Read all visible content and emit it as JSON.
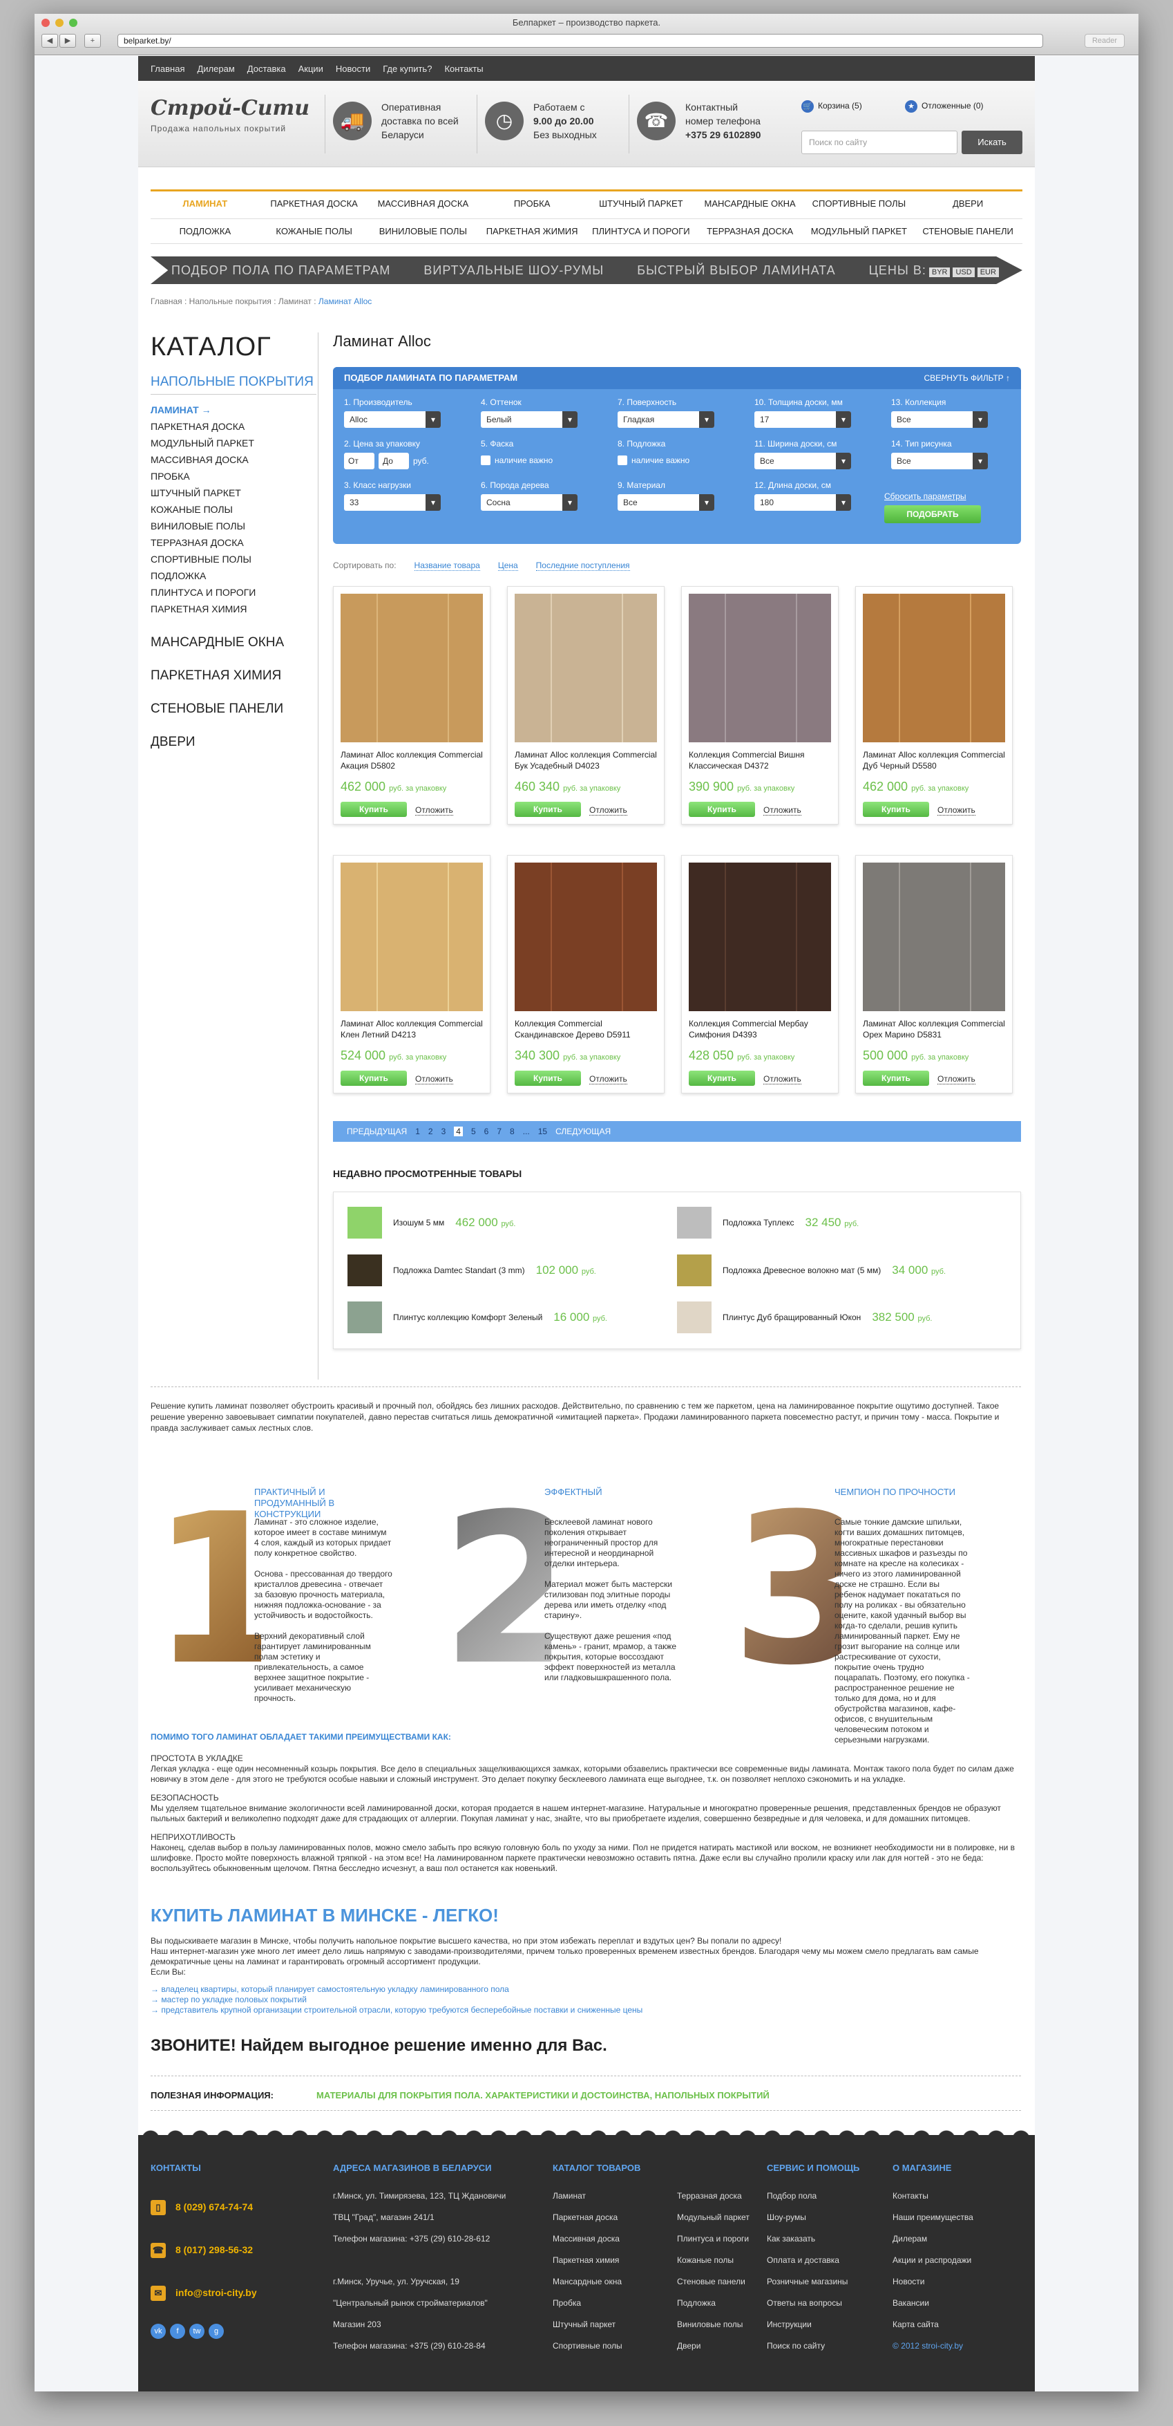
{
  "browser": {
    "window_title": "Белпаркет – производство паркета.",
    "url": "belparket.by/",
    "reader": "Reader"
  },
  "topnav": [
    "Главная",
    "Дилерам",
    "Доставка",
    "Акции",
    "Новости",
    "Где купить?",
    "Контакты"
  ],
  "header": {
    "logo": "Строй-Сити",
    "logo_sub": "Продажа напольных покрытий",
    "delivery": [
      "Оперативная",
      "доставка по всей",
      "Беларуси"
    ],
    "hours": [
      "Работаем с",
      "9.00 до 20.00",
      "Без выходных"
    ],
    "phone": [
      "Контактный",
      "номер телефона",
      "+375 29 6102890"
    ],
    "cart": "Корзина (5)",
    "favorites": "Отложенные (0)",
    "search_placeholder": "Поиск по сайту",
    "search_button": "Искать"
  },
  "categories_row1": [
    "Ламинат",
    "Паркетная доска",
    "Массивная доска",
    "Пробка",
    "Штучный паркет",
    "Мансардные окна",
    "Спортивные полы",
    "Двери"
  ],
  "categories_row2": [
    "Подложка",
    "Кожаные полы",
    "Виниловые полы",
    "Паркетная жимия",
    "Плинтуса и пороги",
    "Терразная доска",
    "Модульный паркет",
    "Стеновые панели"
  ],
  "promo": {
    "items": [
      "Подбор пола по параметрам",
      "Виртуальные шоу-румы",
      "Быстрый выбор ламината"
    ],
    "currency_label": "Цены в:",
    "currencies": [
      "BYR",
      "USD",
      "EUR"
    ]
  },
  "breadcrumb": {
    "path": "Главная : Напольные покрытия : Ламинат :",
    "current": "Ламинат Alloc"
  },
  "sidebar": {
    "title": "Каталог",
    "section": "Напольные покрытия",
    "items": [
      "Ламинат →",
      "Паркетная доска",
      "Модульный паркет",
      "Массивная доска",
      "Пробка",
      "Штучный паркет",
      "Кожаные полы",
      "Виниловые полы",
      "Терразная доска",
      "Спортивные полы",
      "Подложка",
      "Плинтуса и пороги",
      "Паркетная химия"
    ],
    "big": [
      "Мансардные окна",
      "Паркетная химия",
      "Стеновые панели",
      "Двери"
    ]
  },
  "main_title": "Ламинат Alloc",
  "filter": {
    "title": "Подбор ламината по параметрам",
    "collapse": "Свернуть фильтр ↑",
    "groups": [
      {
        "label": "1. Производитель",
        "value": "Alloc"
      },
      {
        "label": "4. Оттенок",
        "value": "Белый"
      },
      {
        "label": "7. Поверхность",
        "value": "Гладкая"
      },
      {
        "label": "10. Толщина доски, мм",
        "value": "17"
      },
      {
        "label": "13. Коллекция",
        "value": "Все"
      },
      {
        "label": "2. Цена за упаковку",
        "from": "От",
        "to": "До",
        "unit": "руб."
      },
      {
        "label": "5. Фаска",
        "check": "наличие важно"
      },
      {
        "label": "8. Подложка",
        "check": "наличие важно"
      },
      {
        "label": "11. Ширина доски, см",
        "value": "Все"
      },
      {
        "label": "14. Тип рисунка",
        "value": "Все"
      },
      {
        "label": "3. Класс нагрузки",
        "value": "33"
      },
      {
        "label": "6. Порода дерева",
        "value": "Сосна"
      },
      {
        "label": "9. Материал",
        "value": "Все"
      },
      {
        "label": "12. Длина доски, см",
        "value": "180"
      }
    ],
    "reset": "Сбросить параметры",
    "submit": "Подобрать"
  },
  "sort": {
    "label": "Сортировать по:",
    "options": [
      "Название товара",
      "Цена",
      "Последние поступления"
    ]
  },
  "products": [
    {
      "name": "Ламинат Alloc коллекция Commercial Акация D5802",
      "price": "462 000",
      "unit": "руб. за упаковку",
      "c1": "#c89a5c",
      "c2": "#dcb57a"
    },
    {
      "name": "Ламинат Alloc коллекция Commercial Бук Усадебный D4023",
      "price": "460 340",
      "unit": "руб. за упаковку",
      "c1": "#c9b394",
      "c2": "#e1d0b5"
    },
    {
      "name": "Коллекция Commercial Вишня Классическая D4372",
      "price": "390 900",
      "unit": "руб. за упаковку",
      "c1": "#8a7a80",
      "c2": "#a89ca0"
    },
    {
      "name": "Ламинат Alloc коллекция Commercial Дуб Черный D5580",
      "price": "462 000",
      "unit": "руб. за упаковку",
      "c1": "#b57a3e",
      "c2": "#d6a060"
    },
    {
      "name": "Ламинат Alloc коллекция Commercial Клен Летний D4213",
      "price": "524 000",
      "unit": "руб. за упаковку",
      "c1": "#d9b271",
      "c2": "#ecd196"
    },
    {
      "name": "Коллекция Commercial Скандинавское Дерево D5911",
      "price": "340 300",
      "unit": "руб. за упаковку",
      "c1": "#7a3f24",
      "c2": "#9c5634"
    },
    {
      "name": "Коллекция Commercial Мербау Симфония D4393",
      "price": "428 050",
      "unit": "руб. за упаковку",
      "c1": "#3f2a22",
      "c2": "#5a3d30"
    },
    {
      "name": "Ламинат Alloc коллекция Commercial Орех Марино D5831",
      "price": "500 000",
      "unit": "руб. за упаковку",
      "c1": "#7d7a76",
      "c2": "#a09c97"
    }
  ],
  "buy_label": "Купить",
  "later_label": "Отложить",
  "pager": {
    "prev": "Предыдущая",
    "pages": [
      "1",
      "2",
      "3",
      "4",
      "5",
      "6",
      "7",
      "8",
      "...",
      "15"
    ],
    "current": "4",
    "next": "Следующая"
  },
  "recent": {
    "title": "Недавно просмотренные товары",
    "items": [
      {
        "name": "Изошум 5 мм",
        "price": "462 000",
        "unit": "руб.",
        "color": "#8fd36a"
      },
      {
        "name": "Подложка Туплекс",
        "price": "32 450",
        "unit": "руб.",
        "color": "#bdbdbd"
      },
      {
        "name": "Подложка Damtec Standart (3 mm)",
        "price": "102 000",
        "unit": "руб.",
        "color": "#3a3020"
      },
      {
        "name": "Подложка Древесноe волокно мат (5 мм)",
        "price": "34 000",
        "unit": "руб.",
        "color": "#b4a04a"
      },
      {
        "name": "Плинтус коллекцию Комфорт Зеленый",
        "price": "16 000",
        "unit": "руб.",
        "color": "#8ca290"
      },
      {
        "name": "Плинтус Дуб бращированный Юкон",
        "price": "382 500",
        "unit": "руб.",
        "color": "#e0d6c6"
      }
    ]
  },
  "intro": "Решение купить ламинат позволяет обустроить красивый и прочный пол, обойдясь без лишних расходов. Действительно, по сравнению с тем же паркетом, цена на ламинированное покрытие ощутимо доступней. Такое решение уверенно завоевывает симпатии покупателей, давно перестав считаться лишь демократичной «имитацией паркета». Продажи ламинированного паркета повсеместно растут, и причин тому - масса. Покрытие и правда заслуживает самых лестных слов.",
  "features": [
    {
      "num": "1",
      "title": "Практичный и продуманный в конструкции",
      "text": "Ламинат - это сложное изделие, которое имеет в составе минимум 4 слоя, каждый из которых придает полу конкретное свойство.\n\nОснова - прессованная до твердого кристаллов древесина - отвечает за базовую прочность материала, нижняя подложка-основание - за устойчивость и водостойкость.\n\nВерхний декоративный слой гарантирует ламинированным полам эстетику и привлекательность, а самое верхнее защитное покрытие - усиливает механическую прочность."
    },
    {
      "num": "2",
      "title": "Эффектный",
      "text": "Бесклеевой ламинат нового поколения открывает неограниченный простор для интересной и неординарной отделки интерьера.\n\nМатериал может быть мастерски стилизован под элитные породы дерева или иметь отделку «под старину».\n\nСуществуют даже решения «под камень» - гранит, мрамор, а также покрытия, которые воссоздают эффект поверхностей из металла или гладковышкрашенного пола."
    },
    {
      "num": "3",
      "title": "Чемпион по прочности",
      "text": "Самые тонкие дамские шпильки, когти ваших домашних питомцев, многократные перестановки массивных шкафов и разъезды по комнате на кресле на колесиках - ничего из этого ламинированной доске не страшно. Если вы ребенок надумает покататься по полу на роликах - вы обязательно оцените, какой удачный выбор вы когда-то сделали, решив купить ламинированный паркет. Ему не грозит выгорание на солнце или растрескивание от сухости, покрытие очень трудно поцарапать. Поэтому, его покупка - распространенное решение не только для дома, но и для обустройства магазинов, кафе-офисов, с внушительным человеческим потоком и серьезными нагрузками."
    }
  ],
  "advantages": {
    "heading": "Помимо того ламинат обладает такими преимуществами как:",
    "items": [
      {
        "title": "Простота в укладке",
        "text": "Легкая укладка - еще один несомненный козырь покрытия. Все дело в специальных защелкивающихся замках, которыми обзавелись практически все современные виды ламината. Монтаж такого пола будет по силам даже новичку в этом деле - для этого не требуются особые навыки и сложный инструмент. Это делает покупку бесклеевого ламината еще выгоднее, т.к. он позволяет неплохо сэкономить и на укладке."
      },
      {
        "title": "Безопасность",
        "text": "Мы уделяем тщательное внимание экологичности всей ламинированной доски, которая продается в нашем интернет-магазине. Натуральные и многократно проверенные решения, представленных брендов не образуют пыльных бактерий и великолепно подходят даже для страдающих от аллергии. Покупая ламинат у нас, знайте, что вы приобретаете изделия, совершенно безвредные и для человека, и для домашних питомцев."
      },
      {
        "title": "Неприхотливость",
        "text": "Наконец, сделав выбор в пользу ламинированных полов, можно смело забыть про всякую головную боль по уходу за ними. Пол не придется натирать мастикой или воском, не возникнет необходимости ни в полировке, ни в шлифовке. Просто мойте поверхность влажной тряпкой - на этом все! На ламинированном паркете практически невозможно оставить пятна. Даже если вы случайно пролили краску или лак для ногтей - это не беда: воспользуйтесь обыкновенным щелочом. Пятна бесследно исчезнут, а ваш пол останется как новенький."
      }
    ]
  },
  "buy_block": {
    "title": "Купить ламинат в Минске - легко!",
    "text": "Вы подыскиваете магазин в Минске, чтобы получить напольное покрытие высшего качества, но при этом избежать переплат и вздутых цен? Вы попали по адресу!\nНаш интернет-магазин уже много лет имеет дело лишь напрямую с заводами-производителями, причем только проверенных временем известных брендов. Благодаря чему мы можем смело предлагать вам самые демократичные цены на ламинат и гарантировать огромный ассортимент продукции.\nЕсли Вы:",
    "links": [
      "→  владелец квартиры, который планирует самостоятельную укладку ламинированного пола",
      "→  мастер по укладке половых покрытий",
      "→  представитель крупной организации строительной отрасли, которую требуются бесперебойные поставки и сниженные цены"
    ],
    "call": "ЗВОНИТЕ! Найдем выгодное решение именно для Вас."
  },
  "useful": {
    "label": "Полезная информация:",
    "link": "Материалы для покрытия пола. Характеристики и достоинства, напольных покрытий"
  },
  "footer": {
    "contacts_title": "Контакты",
    "phones": [
      "8 (029) 674-74-74",
      "8 (017) 298-56-32"
    ],
    "email": "info@stroi-city.by",
    "address_title": "Адреса магазинов в Беларуси",
    "addresses": [
      "г.Минск, ул. Тимирязева, 123, ТЦ Ждановичи",
      "ТВЦ \"Град\", магазин 241/1",
      "Телефон магазина: +375 (29) 610-28-612",
      "",
      "г.Минск, Уручье, ул. Уручская, 19",
      "\"Центральный рынок стройматериалов\"",
      "Магазин 203",
      "Телефон магазина: +375 (29) 610-28-84"
    ],
    "catalog_title": "Каталог товаров",
    "catalog_col1": [
      "Ламинат",
      "Паркетная доска",
      "Массивная доска",
      "Паркетная химия",
      "Мансардные окна",
      "Пробка",
      "Штучный паркет",
      "Спортивные полы"
    ],
    "catalog_col2": [
      "Терразная доска",
      "Модульный паркет",
      "Плинтуса и пороги",
      "Кожаные полы",
      "Стеновые панели",
      "Подложка",
      "Виниловые полы",
      "Двери"
    ],
    "service_title": "Сервис и помощь",
    "service": [
      "Подбор пола",
      "Шоу-румы",
      "Как заказать",
      "Оплата и доставка",
      "Розничные магазины",
      "Ответы на вопросы",
      "Инструкции",
      "Поиск по сайту"
    ],
    "about_title": "О магазине",
    "about": [
      "Контакты",
      "Наши преимущества",
      "Дилерам",
      "Акции и распродажи",
      "Новости",
      "Вакансии",
      "Карта сайта"
    ],
    "copyright": "© 2012 stroi-city.by",
    "social": [
      "vk",
      "f",
      "tw",
      "g"
    ]
  }
}
